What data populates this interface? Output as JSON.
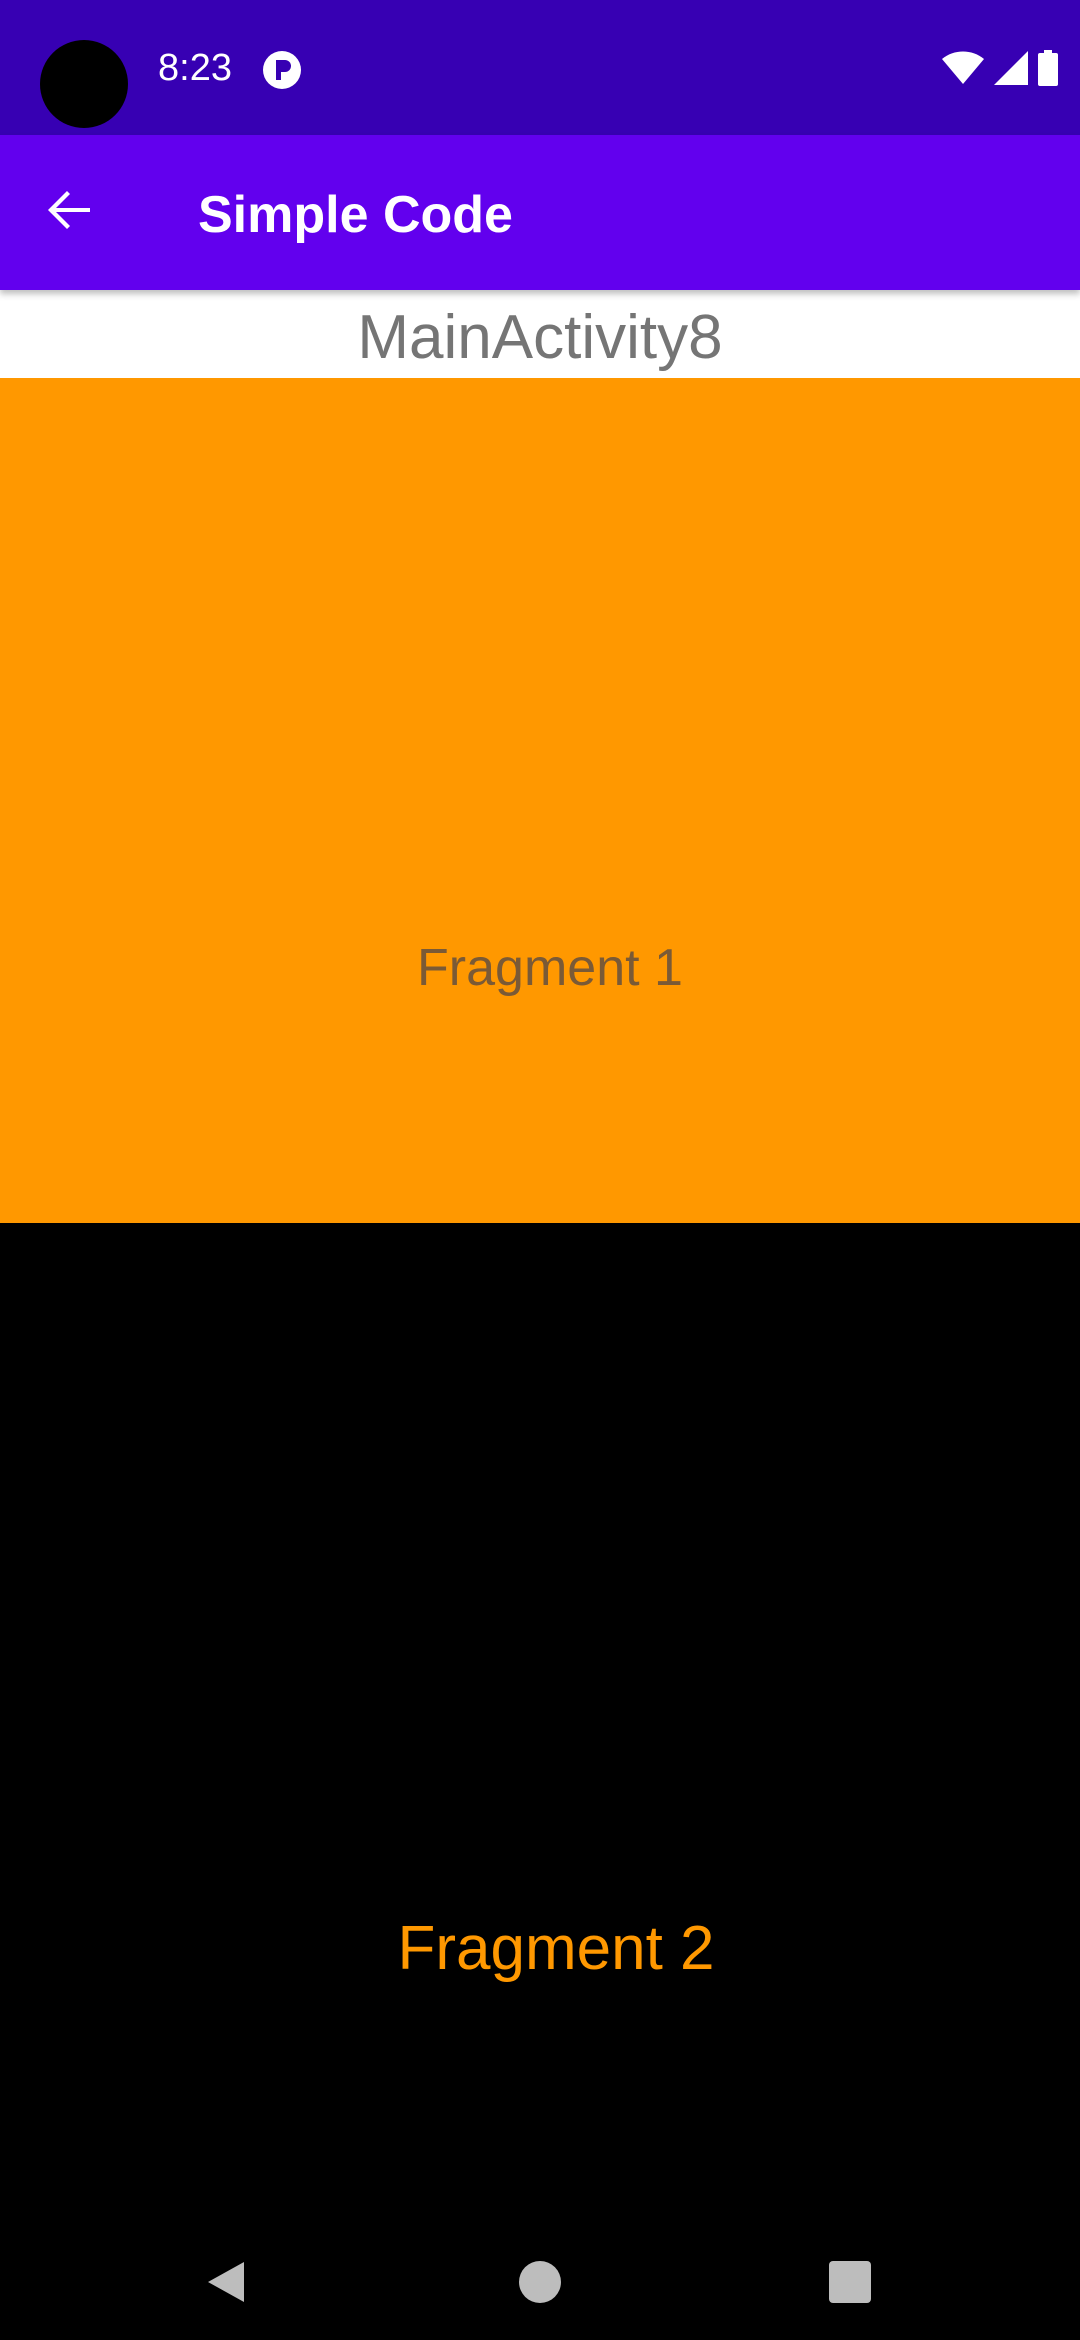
{
  "status_bar": {
    "time": "8:23",
    "app_icon": "parking-notification-icon",
    "icons": [
      "wifi-icon",
      "signal-icon",
      "battery-icon"
    ],
    "background": "#3700B3"
  },
  "app_bar": {
    "title": "Simple Code",
    "back_icon": "arrow-back-icon",
    "background": "#6200EE"
  },
  "activity": {
    "label": "MainActivity8"
  },
  "fragments": [
    {
      "label": "Fragment 1",
      "background": "#FF9800",
      "text_color": "#7a5a36"
    },
    {
      "label": "Fragment 2",
      "background": "#000000",
      "text_color": "#FF9800"
    }
  ],
  "nav_bar": {
    "buttons": [
      "nav-back-icon",
      "nav-home-icon",
      "nav-recents-icon"
    ]
  }
}
